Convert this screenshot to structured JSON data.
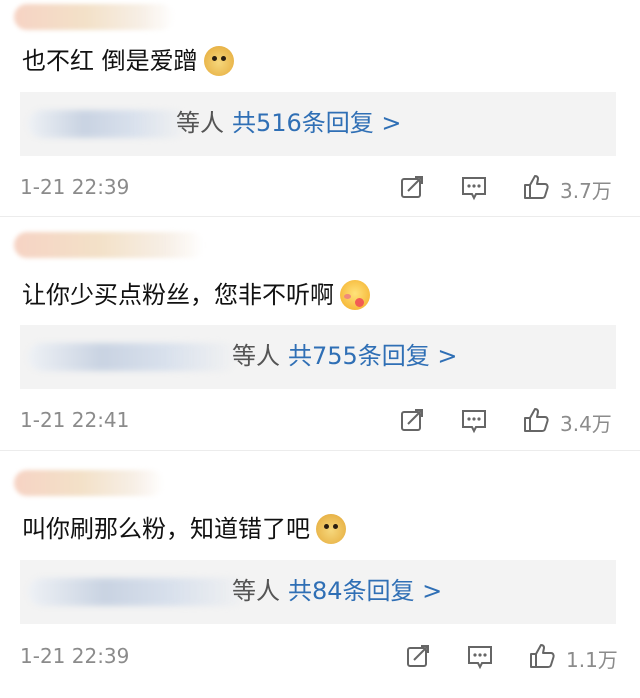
{
  "comments": [
    {
      "text": "也不红 倒是爱蹭",
      "emoji": "doge-emoji",
      "reply_others": "等人",
      "reply_total": "共516条回复 >",
      "time": "1-21 22:39",
      "likes": "3.7万"
    },
    {
      "text": "让你少买点粉丝，您非不听啊",
      "emoji": "blush-kiss-emoji",
      "reply_others": "等人",
      "reply_total": "共755条回复 >",
      "time": "1-21 22:41",
      "likes": "3.4万"
    },
    {
      "text": "叫你刷那么粉，知道错了吧",
      "emoji": "doge-emoji",
      "reply_others": "等人",
      "reply_total": "共84条回复 >",
      "time": "1-21 22:39",
      "likes": "1.1万"
    }
  ],
  "icons": {
    "forward": "repost-icon",
    "reply": "comment-icon",
    "like": "thumbs-up-icon"
  },
  "colors": {
    "link": "#2f6fb5",
    "muted": "#8b8b8b",
    "reply_bg": "#f3f3f3"
  }
}
